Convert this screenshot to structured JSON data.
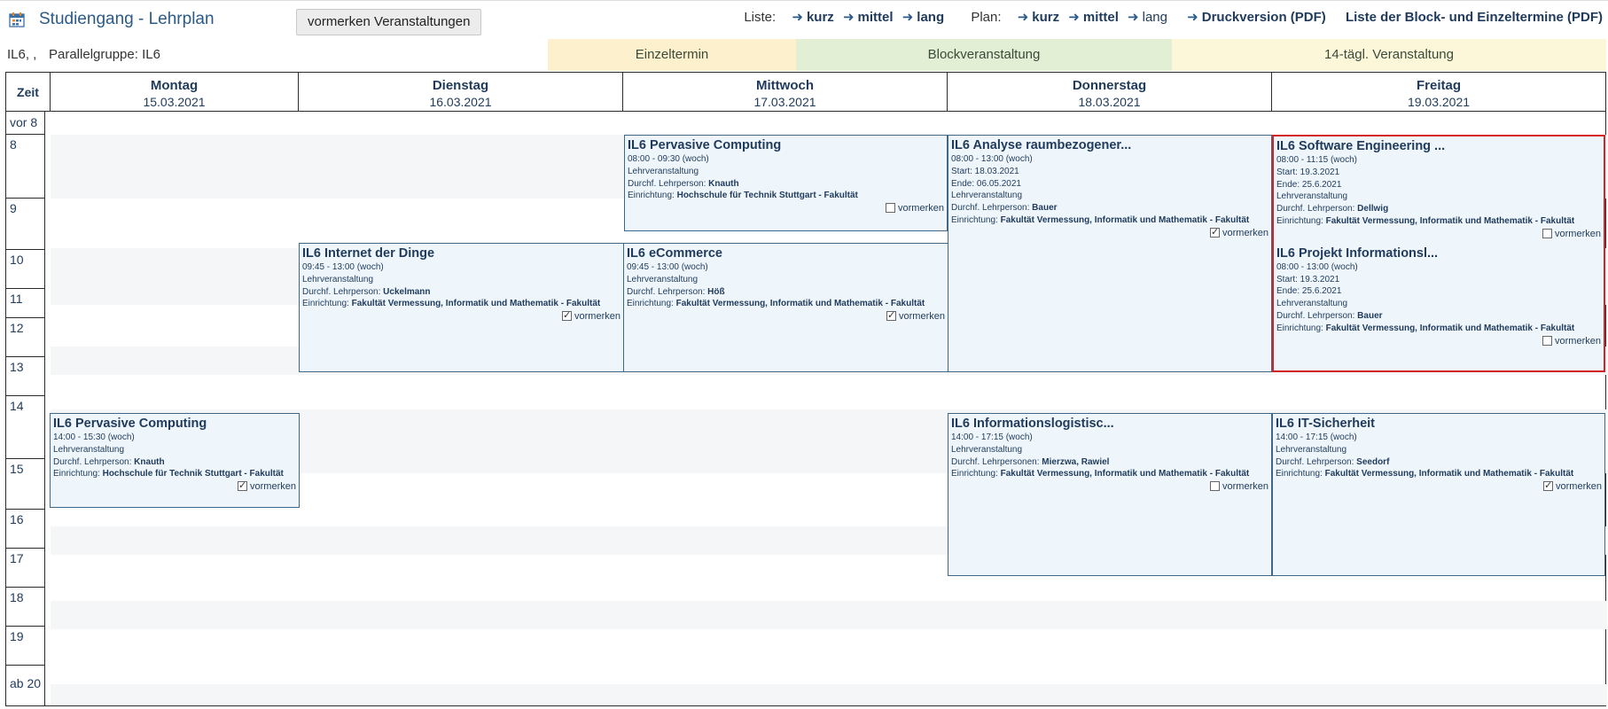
{
  "header": {
    "title": "Studiengang - Lehrplan",
    "vormerken_button": "vormerken Veranstaltungen",
    "liste_label": "Liste:",
    "liste_links": [
      "kurz",
      "mittel",
      "lang"
    ],
    "plan_label": "Plan:",
    "plan_links": [
      "kurz",
      "mittel",
      "lang"
    ],
    "druck_link": "Druckversion (PDF)",
    "termine_link": "Liste der Block- und Einzeltermine (PDF)"
  },
  "info": {
    "group": "IL6, ,",
    "parallel": "Parallelgruppe: IL6"
  },
  "legend": {
    "einzel": "Einzeltermin",
    "block": "Blockveranstaltung",
    "tagl": "14-tägl. Veranstaltung"
  },
  "grid": {
    "corner": "Zeit",
    "days": [
      {
        "name": "Montag",
        "date": "15.03.2021"
      },
      {
        "name": "Dienstag",
        "date": "16.03.2021"
      },
      {
        "name": "Mittwoch",
        "date": "17.03.2021"
      },
      {
        "name": "Donnerstag",
        "date": "18.03.2021"
      },
      {
        "name": "Freitag",
        "date": "19.03.2021"
      }
    ],
    "times": [
      "vor 8",
      "8",
      "9",
      "10",
      "11",
      "12",
      "13",
      "14",
      "15",
      "16",
      "17",
      "18",
      "19",
      "ab 20"
    ]
  },
  "events": {
    "mi_pervasive": {
      "title": "IL6 Pervasive Computing",
      "time": "08:00 - 09:30 (woch)",
      "type": "Lehrveranstaltung",
      "person_label": "Durchf. Lehrperson:",
      "person": "Knauth",
      "inst_label": "Einrichtung:",
      "inst": "Hochschule für Technik Stuttgart - Fakultät",
      "vormerken": "vormerken"
    },
    "do_analyse": {
      "title": "IL6 Analyse raumbezogener...",
      "time": "08:00 - 13:00 (woch)",
      "start": "Start:  18.03.2021",
      "end": "Ende:  06.05.2021",
      "type": "Lehrveranstaltung",
      "person_label": "Durchf. Lehrperson:",
      "person": "Bauer",
      "inst_label": "Einrichtung:",
      "inst": "Fakultät Vermessung, Informatik und Mathematik - Fakultät",
      "vormerken": "vormerken"
    },
    "fr_software": {
      "title": "IL6 Software Engineering ...",
      "time": "08:00 - 11:15 (woch)",
      "start": "Start:  19.3.2021",
      "end": "Ende:  25.6.2021",
      "type": "Lehrveranstaltung",
      "person_label": "Durchf. Lehrperson:",
      "person": "Dellwig",
      "inst_label": "Einrichtung:",
      "inst": "Fakultät Vermessung, Informatik und Mathematik - Fakultät",
      "vormerken": "vormerken"
    },
    "fr_projekt": {
      "title": "IL6 Projekt Informationsl...",
      "time": "08:00 - 13:00 (woch)",
      "start": "Start:  19.3.2021",
      "end": "Ende:  25.6.2021",
      "type": "Lehrveranstaltung",
      "person_label": "Durchf. Lehrperson:",
      "person": "Bauer",
      "inst_label": "Einrichtung:",
      "inst": "Fakultät Vermessung, Informatik und Mathematik - Fakultät",
      "vormerken": "vormerken"
    },
    "di_internet": {
      "title": "IL6 Internet der Dinge",
      "time": "09:45 - 13:00 (woch)",
      "type": "Lehrveranstaltung",
      "person_label": "Durchf. Lehrperson:",
      "person": "Uckelmann",
      "inst_label": "Einrichtung:",
      "inst": "Fakultät Vermessung, Informatik und Mathematik - Fakultät",
      "vormerken": "vormerken"
    },
    "mi_ecommerce": {
      "title": "IL6 eCommerce",
      "time": "09:45 - 13:00 (woch)",
      "type": "Lehrveranstaltung",
      "person_label": "Durchf. Lehrperson:",
      "person": "Höß",
      "inst_label": "Einrichtung:",
      "inst": "Fakultät Vermessung, Informatik und Mathematik - Fakultät",
      "vormerken": "vormerken"
    },
    "mo_pervasive": {
      "title": "IL6 Pervasive Computing",
      "time": "14:00 - 15:30 (woch)",
      "type": "Lehrveranstaltung",
      "person_label": "Durchf. Lehrperson:",
      "person": "Knauth",
      "inst_label": "Einrichtung:",
      "inst": "Hochschule für Technik Stuttgart - Fakultät",
      "vormerken": "vormerken"
    },
    "do_infolog": {
      "title": "IL6 Informationslogistisc...",
      "time": "14:00 - 17:15 (woch)",
      "type": "Lehrveranstaltung",
      "person_label": "Durchf. Lehrpersonen:",
      "person": "Mierzwa,  Rawiel",
      "inst_label": "Einrichtung:",
      "inst": "Fakultät Vermessung, Informatik und Mathematik - Fakultät",
      "vormerken": "vormerken"
    },
    "fr_itsicherheit": {
      "title": "IL6 IT-Sicherheit",
      "time": "14:00 - 17:15 (woch)",
      "type": "Lehrveranstaltung",
      "person_label": "Durchf. Lehrperson:",
      "person": "Seedorf",
      "inst_label": "Einrichtung:",
      "inst": "Fakultät Vermessung, Informatik und Mathematik - Fakultät",
      "vormerken": "vormerken"
    }
  }
}
